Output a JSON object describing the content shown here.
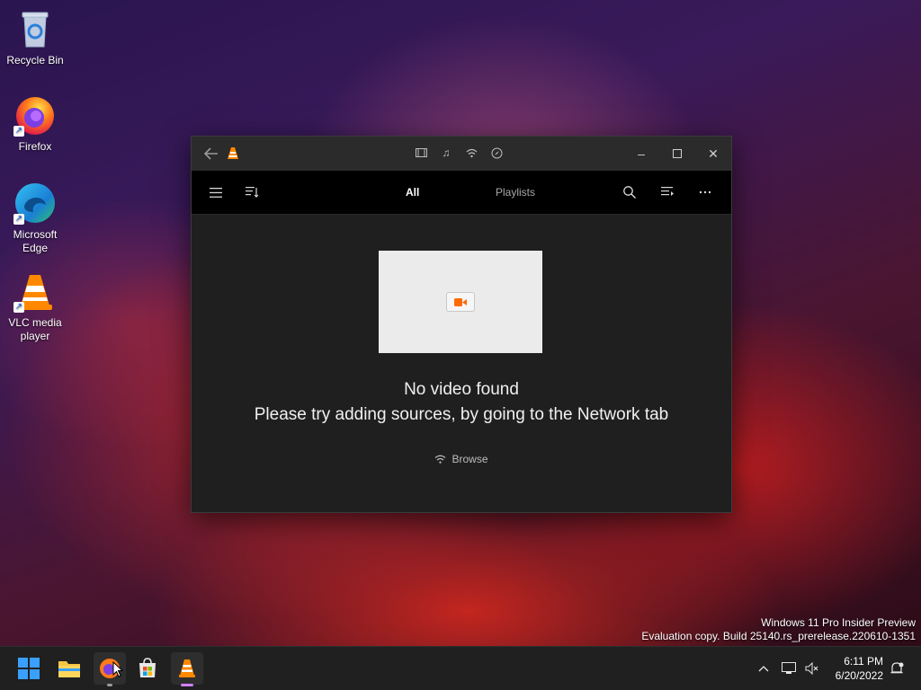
{
  "desktop": {
    "icons": [
      {
        "label": "Recycle Bin"
      },
      {
        "label": "Firefox"
      },
      {
        "label": "Microsoft Edge"
      },
      {
        "label": "VLC media player"
      }
    ],
    "watermark": {
      "line1": "Windows 11 Pro Insider Preview",
      "line2": "Evaluation copy. Build 25140.rs_prerelease.220610-1351"
    }
  },
  "vlc": {
    "titlebar": {
      "back_icon": "back-arrow-icon",
      "app_icon": "vlc-cone-icon",
      "mid_icons": [
        "video-icon",
        "music-icon",
        "network-icon",
        "browse-icon"
      ],
      "minimize": "–",
      "maximize": "☐",
      "close": "✕"
    },
    "navbar": {
      "tabs": [
        {
          "label": "All",
          "active": true
        },
        {
          "label": "Playlists",
          "active": false
        }
      ]
    },
    "content": {
      "title": "No video found",
      "subtitle": "Please try adding sources, by going to the Network tab",
      "browse_label": "Browse"
    }
  },
  "taskbar": {
    "clock": {
      "time": "6:11 PM",
      "date": "6/20/2022"
    },
    "colors": {
      "vlc_accent": "#ff8800",
      "taskbar_bg": "#202020"
    }
  }
}
